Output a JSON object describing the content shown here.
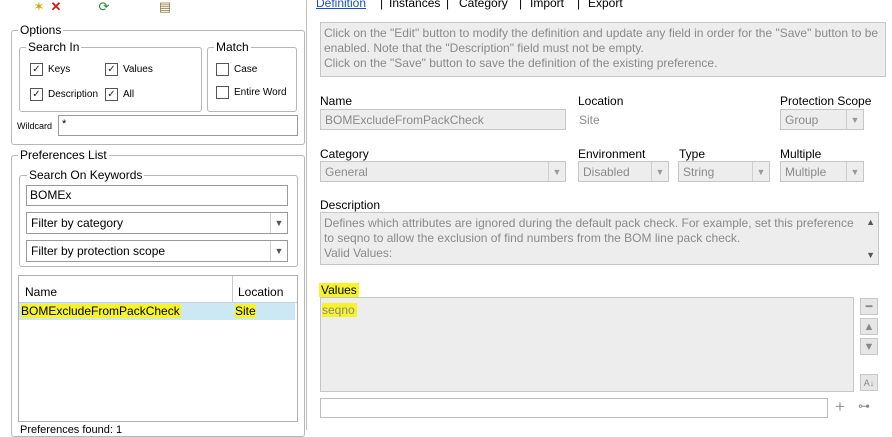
{
  "toolbar": {
    "icons": [
      "star-icon",
      "delete-icon",
      "refresh-icon",
      "document-icon"
    ]
  },
  "tabs": [
    {
      "label": "Definition"
    },
    {
      "label": "Instances"
    },
    {
      "label": "Category"
    },
    {
      "label": "Import"
    },
    {
      "label": "Export"
    }
  ],
  "options": {
    "legend": "Options",
    "search_in": {
      "legend": "Search In",
      "keys": "Keys",
      "values": "Values",
      "description": "Description",
      "all": "All"
    },
    "match": {
      "legend": "Match",
      "case": "Case",
      "entire_word": "Entire Word"
    },
    "wildcard_label": "Wildcard",
    "wildcard_value": "*"
  },
  "preferences_list": {
    "legend": "Preferences List",
    "search_keywords": {
      "legend": "Search On Keywords",
      "value": "BOMEx"
    },
    "filter_category": "Filter by category",
    "filter_scope": "Filter by protection scope",
    "table": {
      "headers": {
        "name": "Name",
        "location": "Location"
      },
      "rows": [
        {
          "name": "BOMExcludeFromPackCheck",
          "location": "Site"
        }
      ]
    },
    "found_text": "Preferences found: 1"
  },
  "definition": {
    "info_text": "Click on the \"Edit\" button to modify the definition and update any field in order for the \"Save\" button to be enabled. Note that the \"Description\" field must not be empty.\nClick on the \"Save\" button to save the definition of the existing preference.",
    "name_label": "Name",
    "name_value": "BOMExcludeFromPackCheck",
    "location_label": "Location",
    "location_value": "Site",
    "scope_label": "Protection Scope",
    "scope_value": "Group",
    "category_label": "Category",
    "category_value": "General",
    "environment_label": "Environment",
    "environment_value": "Disabled",
    "type_label": "Type",
    "type_value": "String",
    "multiple_label": "Multiple",
    "multiple_value": "Multiple",
    "description_label": "Description",
    "description_text": "Defines which attributes are ignored during the default pack check. For example, set this preference to seqno to allow the exclusion of find numbers from the BOM line pack check.\nValid Values:",
    "values_label": "Values",
    "values_list": [
      "seqno"
    ],
    "new_value": ""
  },
  "colors": {
    "highlight": "#f6f32a",
    "selected_row": "#cde8f5"
  }
}
